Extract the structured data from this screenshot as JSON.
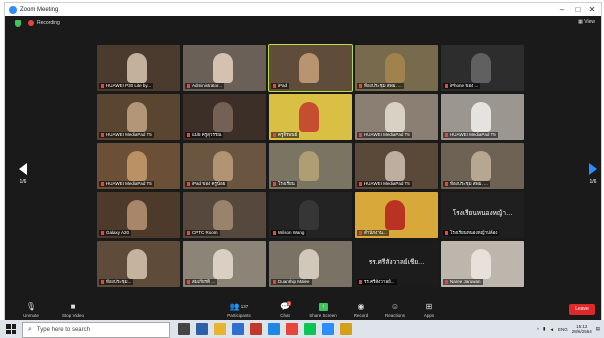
{
  "window": {
    "title": "Zoom Meeting"
  },
  "topbar": {
    "recording_label": "Recording",
    "view_label": "View"
  },
  "pager": {
    "left": "1/6",
    "right": "1/6"
  },
  "tiles": [
    {
      "name": "HUAWEI P30 Lite by...",
      "bg": "#4b3a2e",
      "accent": "#d9c7b0"
    },
    {
      "name": "Administrator...",
      "bg": "#6b6058",
      "accent": "#e8d2c0"
    },
    {
      "name": "iPad",
      "bg": "#5f4c3a",
      "accent": "#c8a27a",
      "active": true
    },
    {
      "name": "ห้องประชุม สพม. ...",
      "bg": "#786a4c",
      "accent": "#a6864c"
    },
    {
      "name": "iPhone ของ ...",
      "bg": "#2d2d2d",
      "accent": "#6a6a6a"
    },
    {
      "name": "HUAWEI MediaPad T5",
      "bg": "#5a4530",
      "accent": "#c2a484"
    },
    {
      "name": "แม่ย ครูสุวรรณ",
      "bg": "#3b2f28",
      "accent": "#7f6a5c"
    },
    {
      "name": "ครูจิรพนธ์",
      "bg": "#d9c045",
      "accent": "#c0392b"
    },
    {
      "name": "HUAWEI MediaPad T5",
      "bg": "#8a7f72",
      "accent": "#e7dfd4"
    },
    {
      "name": "HUAWEI MediaPad T5",
      "bg": "#9b9690",
      "accent": "#f2f0ee"
    },
    {
      "name": "HUAWEI MediaPad T5",
      "bg": "#6b4f36",
      "accent": "#c89b6d"
    },
    {
      "name": "iPad ของ ครูน้อย",
      "bg": "#6a5541",
      "accent": "#bda07a"
    },
    {
      "name": "โรงเรียน",
      "bg": "#7a7462",
      "accent": "#b9a477"
    },
    {
      "name": "HUAWEI MediaPad T5",
      "bg": "#5a4838",
      "accent": "#d0c1b2"
    },
    {
      "name": "ห้องประชุม สพม. ...",
      "bg": "#6e6254",
      "accent": "#c4b39c"
    },
    {
      "name": "Galaxy A20",
      "bg": "#4d3a2b",
      "accent": "#b89476"
    },
    {
      "name": "CPTC Room",
      "bg": "#57483d",
      "accent": "#a48e76"
    },
    {
      "name": "Wilson Wang",
      "bg": "#232323",
      "accent": "#3a3a3a"
    },
    {
      "name": "สำนักงาน...",
      "bg": "#d8a83a",
      "accent": "#b51d1d"
    },
    {
      "name": "โรงเรียนหนองหญ้าปล้อง",
      "bg": "#1f1f1f",
      "accent": "#2a2a2a",
      "text": "โรงเรียนหนองหญ้า..."
    },
    {
      "name": "ห้องประชุม...",
      "bg": "#5e4b3a",
      "accent": "#d7c6b2"
    },
    {
      "name": "สมเกียรติ ...",
      "bg": "#8d8478",
      "accent": "#e6ddd0"
    },
    {
      "name": "Duanthip Malee",
      "bg": "#7b7266",
      "accent": "#e2d7c8"
    },
    {
      "name": "รร.ศรีสังวาลย์...",
      "bg": "#1c1c1c",
      "accent": "#2a2a2a",
      "text": "รร.ศรีสังวาลย์เชีย..."
    },
    {
      "name": "Naree Jaruwan",
      "bg": "#bcb6ad",
      "accent": "#f0e9e0"
    }
  ],
  "toolbar": {
    "unmute": "Unmute",
    "stop_video": "Stop Video",
    "participants": "Participants",
    "participants_count": "137",
    "chat": "Chat",
    "chat_badge": "3",
    "share_screen": "Share Screen",
    "record": "Record",
    "reactions": "Reactions",
    "apps": "Apps",
    "end": "Leave"
  },
  "taskbar": {
    "search_placeholder": "Type here to search",
    "lang": "ENG",
    "time": "15:12",
    "date": "28/6/2564"
  },
  "colors": {
    "accent_blue": "#2d8cff",
    "end_red": "#e02828",
    "active_green": "#b9dc4a"
  }
}
